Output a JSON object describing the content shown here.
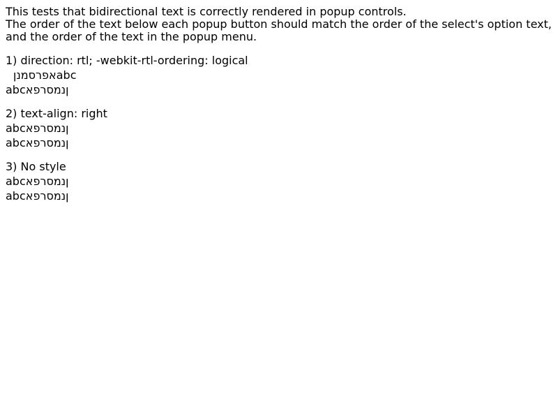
{
  "intro": {
    "line1": "This tests that bidirectional text is correctly rendered in popup controls.",
    "line2": "The order of the text below each popup button should match the order of the select's option text,",
    "line3": "and the order of the text in the popup menu."
  },
  "sections": [
    {
      "title": "1) direction: rtl; -webkit-rtl-ordering: logical",
      "popup_text": "ןנמסרפאabc",
      "text_below": "abcןנמסרפא"
    },
    {
      "title": "2) text-align: right",
      "popup_text": "abcןנמסרפא",
      "text_below": "abcןנמסרפא"
    },
    {
      "title": "3) No style",
      "popup_text": "abcןנמסרפא",
      "text_below": "abcןנמסרפא"
    }
  ]
}
